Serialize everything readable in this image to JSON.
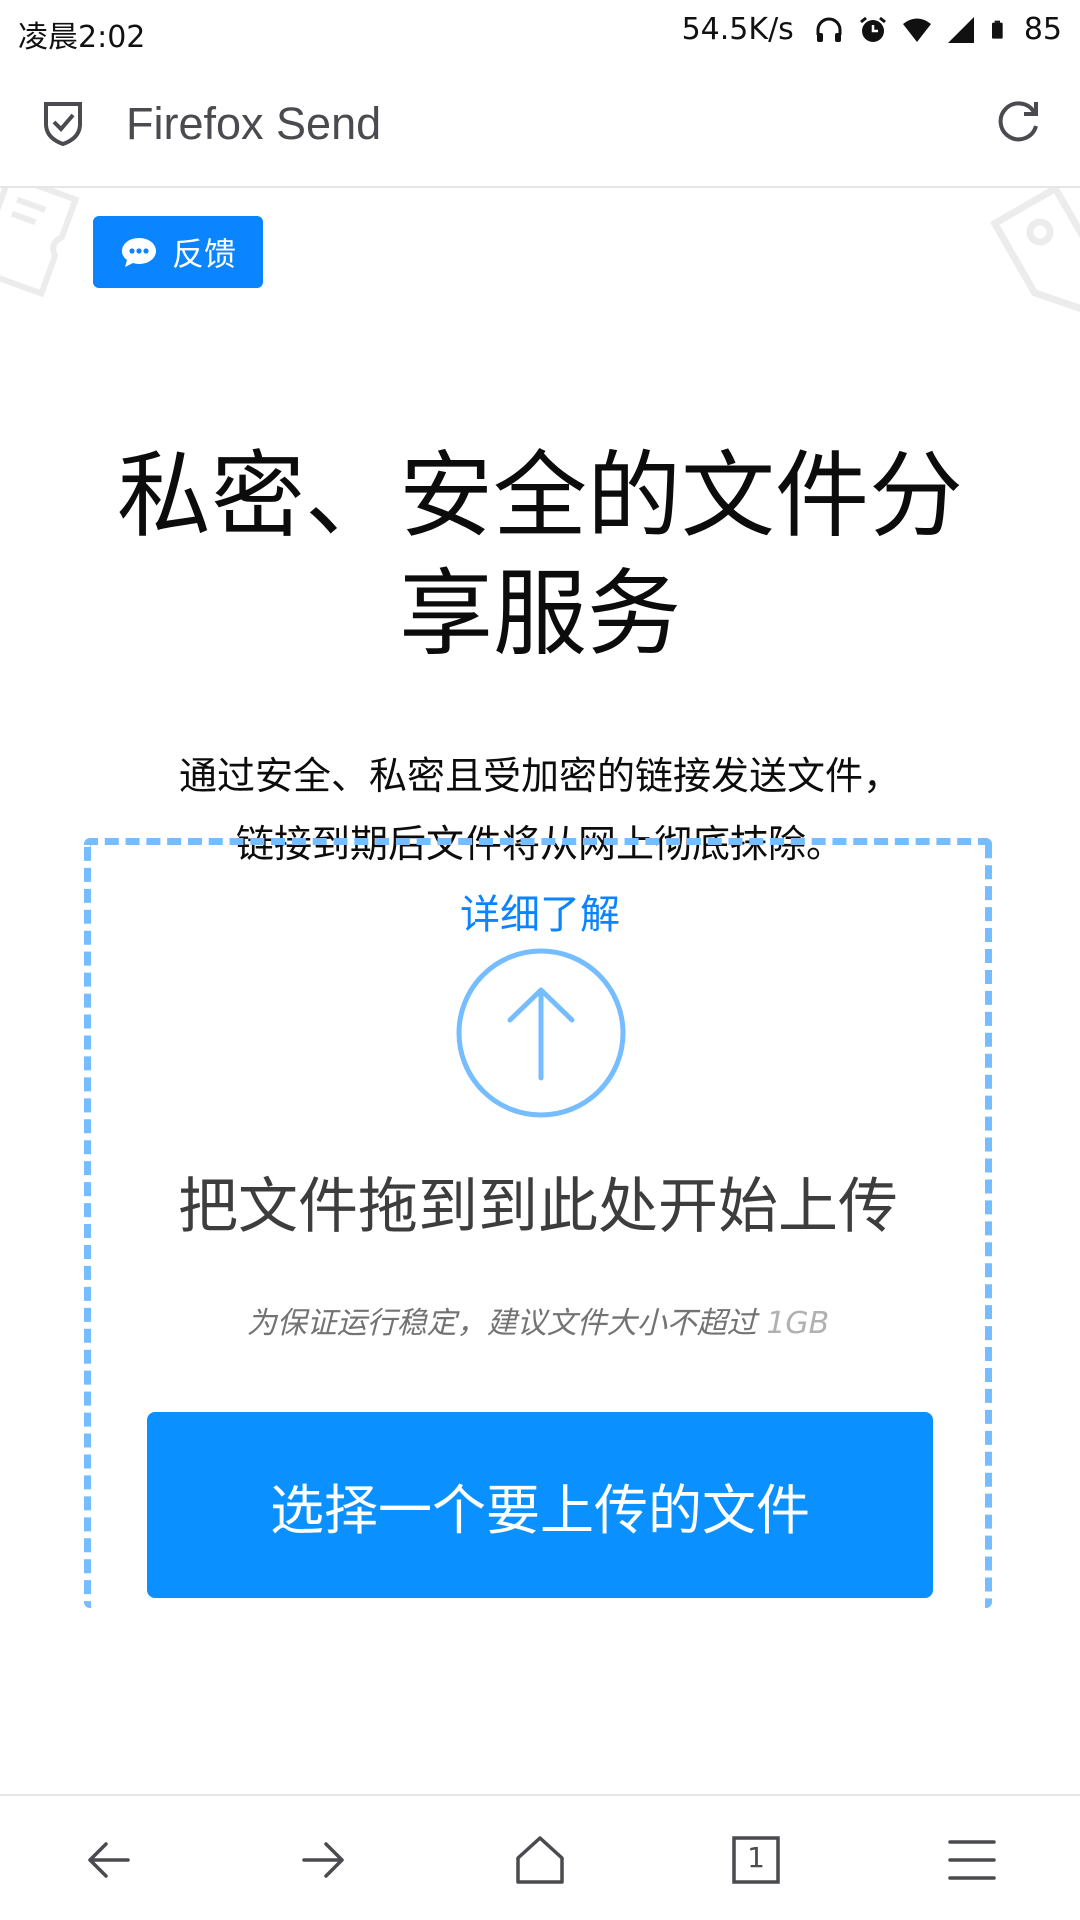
{
  "status_bar": {
    "time": "凌晨2:02",
    "net_speed": "54.5K/s",
    "battery": "85",
    "icons": [
      "headphones-icon",
      "alarm-icon",
      "wifi-icon",
      "signal-icon",
      "battery-icon"
    ]
  },
  "toolbar": {
    "site_title": "Firefox Send",
    "shield_icon": "shield-check-icon",
    "reload_icon": "reload-icon"
  },
  "feedback": {
    "label": "反馈",
    "icon": "chat-bubble-icon"
  },
  "hero": {
    "title_line1": "私密、安全的文件分",
    "title_line2": "享服务",
    "desc_line1": "通过安全、私密且受加密的链接发送文件，",
    "desc_line2": "链接到期后文件将从网上彻底抹除。",
    "learn_more": "详细了解"
  },
  "upload": {
    "icon": "upload-arrow-icon",
    "drop_text": "把文件拖到到此处开始上传",
    "hint_prefix": "为保证运行稳定，建议文件大小不超过",
    "hint_size": "1GB",
    "button_label": "选择一个要上传的文件"
  },
  "bottom_nav": {
    "tab_count": "1",
    "items": [
      "back-icon",
      "forward-icon",
      "home-icon",
      "tabs-icon",
      "menu-icon"
    ]
  },
  "colors": {
    "accent": "#0a84ff",
    "dashed_border": "#75bdff"
  }
}
